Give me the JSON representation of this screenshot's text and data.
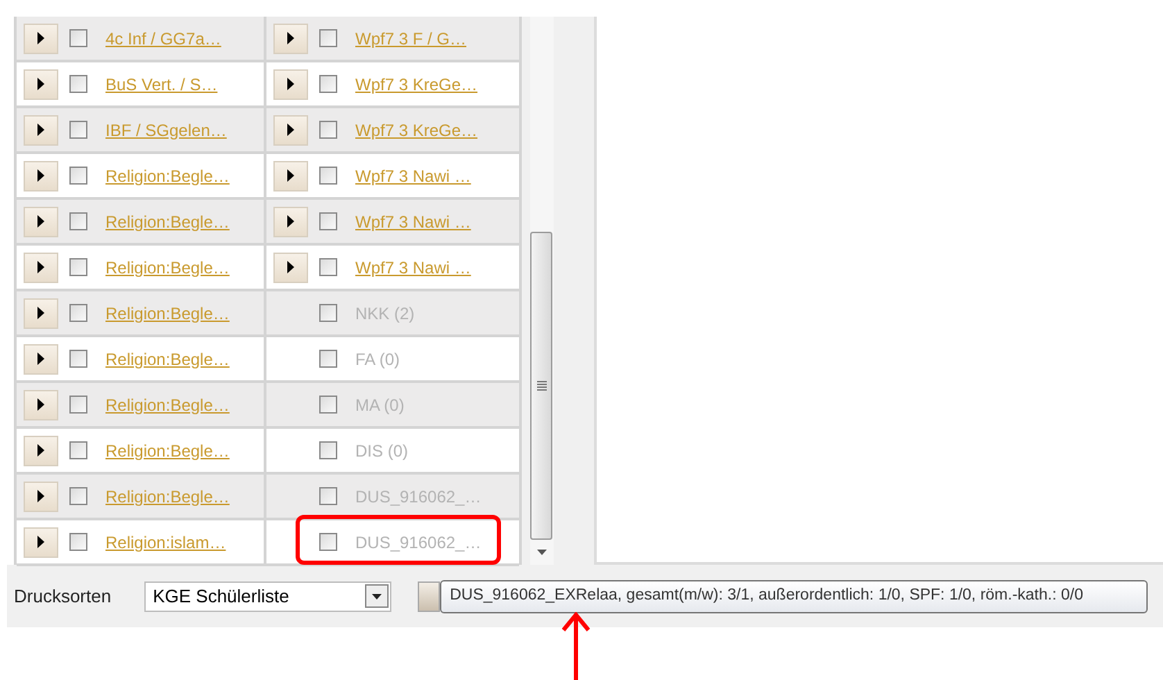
{
  "rows": [
    {
      "left": {
        "label": "4c Inf / GG7a…",
        "expandable": true,
        "checked": false,
        "disabled": false
      },
      "right": {
        "label": "Wpf7 3 F / G…",
        "expandable": true,
        "checked": false,
        "disabled": false,
        "marked": false
      }
    },
    {
      "left": {
        "label": "BuS Vert. / S…",
        "expandable": true,
        "checked": false,
        "disabled": false
      },
      "right": {
        "label": "Wpf7 3 KreGe…",
        "expandable": true,
        "checked": false,
        "disabled": false,
        "marked": false
      }
    },
    {
      "left": {
        "label": "IBF / SGgelen…",
        "expandable": true,
        "checked": false,
        "disabled": false
      },
      "right": {
        "label": "Wpf7 3 KreGe…",
        "expandable": true,
        "checked": false,
        "disabled": false,
        "marked": false
      }
    },
    {
      "left": {
        "label": "Religion:Begle…",
        "expandable": true,
        "checked": false,
        "disabled": false
      },
      "right": {
        "label": "Wpf7 3 Nawi …",
        "expandable": true,
        "checked": false,
        "disabled": false,
        "marked": false
      }
    },
    {
      "left": {
        "label": "Religion:Begle…",
        "expandable": true,
        "checked": false,
        "disabled": false
      },
      "right": {
        "label": "Wpf7 3 Nawi …",
        "expandable": true,
        "checked": false,
        "disabled": false,
        "marked": false
      }
    },
    {
      "left": {
        "label": "Religion:Begle…",
        "expandable": true,
        "checked": false,
        "disabled": false
      },
      "right": {
        "label": "Wpf7 3 Nawi …",
        "expandable": true,
        "checked": false,
        "disabled": false,
        "marked": false
      }
    },
    {
      "left": {
        "label": "Religion:Begle…",
        "expandable": true,
        "checked": false,
        "disabled": false
      },
      "right": {
        "label": "NKK (2)",
        "expandable": false,
        "checked": false,
        "disabled": true,
        "marked": false
      }
    },
    {
      "left": {
        "label": "Religion:Begle…",
        "expandable": true,
        "checked": false,
        "disabled": false
      },
      "right": {
        "label": "FA (0)",
        "expandable": false,
        "checked": false,
        "disabled": true,
        "marked": false
      }
    },
    {
      "left": {
        "label": "Religion:Begle…",
        "expandable": true,
        "checked": false,
        "disabled": false
      },
      "right": {
        "label": "MA (0)",
        "expandable": false,
        "checked": false,
        "disabled": true,
        "marked": false
      }
    },
    {
      "left": {
        "label": "Religion:Begle…",
        "expandable": true,
        "checked": false,
        "disabled": false
      },
      "right": {
        "label": "DIS (0)",
        "expandable": false,
        "checked": false,
        "disabled": true,
        "marked": false
      }
    },
    {
      "left": {
        "label": "Religion:Begle…",
        "expandable": true,
        "checked": false,
        "disabled": false
      },
      "right": {
        "label": "DUS_916062_…",
        "expandable": false,
        "checked": false,
        "disabled": true,
        "marked": false
      }
    },
    {
      "left": {
        "label": "Religion:islam…",
        "expandable": true,
        "checked": false,
        "disabled": false
      },
      "right": {
        "label": "DUS_916062_…",
        "expandable": false,
        "checked": false,
        "disabled": true,
        "marked": true
      }
    }
  ],
  "print_types": {
    "label": "Drucksorten",
    "value": "KGE Schülerliste"
  },
  "tooltip": "DUS_916062_EXRelaa, gesamt(m/w): 3/1, außerordentlich: 1/0, SPF: 1/0, röm.-kath.: 0/0"
}
